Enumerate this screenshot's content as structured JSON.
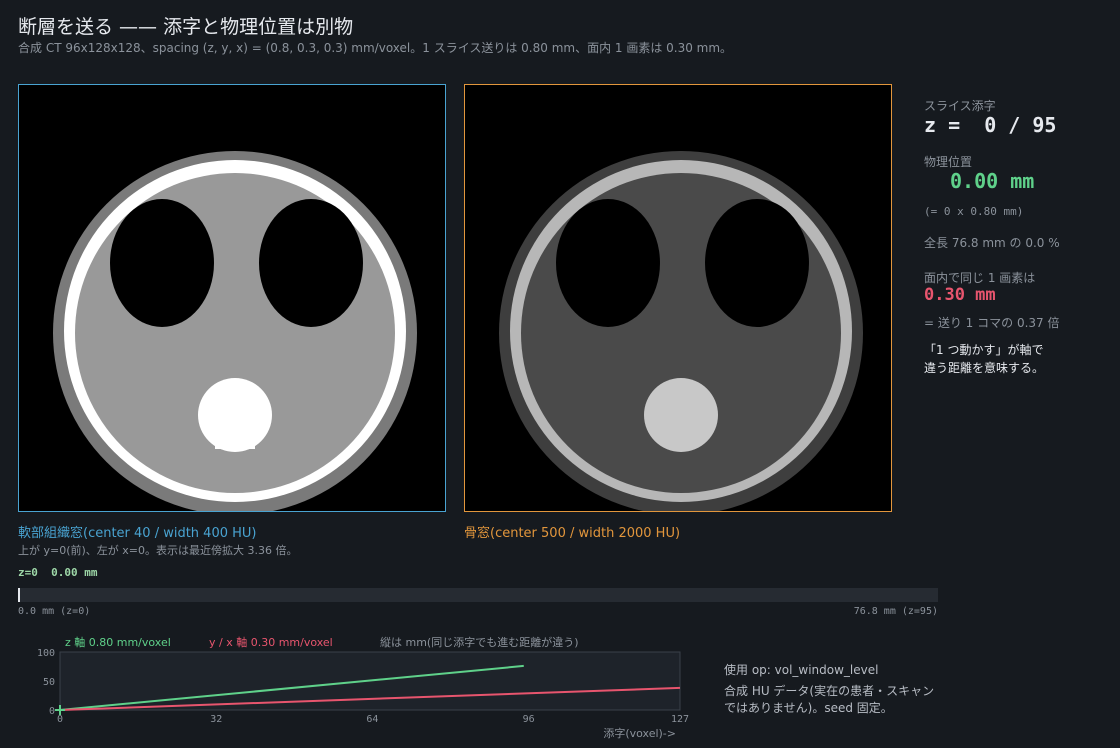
{
  "header": {
    "title": "断層を送る —— 添字と物理位置は別物",
    "subtitle": "合成 CT 96x128x128、spacing (z, y, x) = (0.8, 0.3, 0.3) mm/voxel。1 スライス送りは 0.80 mm、面内 1 画素は 0.30 mm。"
  },
  "viewports": {
    "soft_caption": "軟部組織窓(center 40 / width 400 HU)",
    "bone_caption": "骨窓(center 500 / width 2000 HU)",
    "orientation_note": "上が y=0(前)、左が x=0。表示は最近傍拡大 3.36 倍。",
    "soft_color": "#49a3d1",
    "bone_color": "#e2963c"
  },
  "side": {
    "slice_label": "スライス添字",
    "slice_value": "z =  0 / 95",
    "pos_label": "物理位置",
    "pos_value": "0.00 mm",
    "pos_formula": "(= 0 x 0.80 mm)",
    "total_note": "全長 76.8 mm の 0.0 %",
    "pixel_label": "面内で同じ 1 画素は",
    "pixel_value": "0.30 mm",
    "ratio_note": "= 送り 1 コマの 0.37 倍",
    "meaning_line1": "「1 つ動かす」が軸で",
    "meaning_line2": "違う距離を意味する。"
  },
  "slider": {
    "readout": "z=0  0.00 mm",
    "min_label": "0.0 mm (z=0)",
    "max_label": "76.8 mm (z=95)",
    "value_fraction": 0.0
  },
  "notes": {
    "ops": "使用 op: vol_window_level",
    "data_line1": "合成 HU データ(実在の患者・スキャン",
    "data_line2": "ではありません)。seed 固定。"
  },
  "chart_data": {
    "type": "line",
    "x": [
      0,
      95,
      127
    ],
    "series": [
      {
        "name": "z 軸 0.80 mm/voxel",
        "x": [
          0,
          95
        ],
        "y": [
          0,
          76.0
        ],
        "color": "#5fd18a"
      },
      {
        "name": "y / x 軸 0.30 mm/voxel",
        "x": [
          0,
          127
        ],
        "y": [
          0,
          38.1
        ],
        "color": "#e8556e"
      }
    ],
    "marker": {
      "x": 0,
      "y": 0
    },
    "annotation": "縦は mm(同じ添字でも進む距離が違う)",
    "xlabel": "添字(voxel)->",
    "xticks": [
      0,
      32,
      64,
      96,
      127
    ],
    "yticks": [
      0,
      50,
      100
    ],
    "xlim": [
      0,
      127
    ],
    "ylim": [
      0,
      100
    ],
    "grid": false
  }
}
